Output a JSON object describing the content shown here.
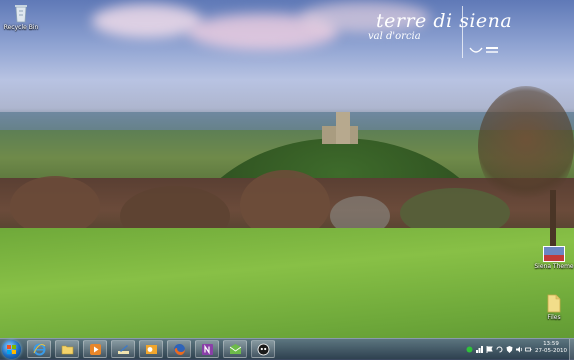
{
  "wallpaper": {
    "brand_title": "terre di siena",
    "brand_subtitle": "val d'orcia"
  },
  "desktop_icons": [
    {
      "name": "recycle-bin",
      "label": "Recycle Bin",
      "icon": "recycle-bin-icon"
    },
    {
      "name": "siena-theme",
      "label": "Siena Theme",
      "icon": "image-thumbnail-icon"
    },
    {
      "name": "files",
      "label": "Files",
      "icon": "folder-icon"
    }
  ],
  "taskbar": {
    "start_icon": "windows-start-orb",
    "pinned": [
      {
        "name": "internet-explorer",
        "icon": "internet-explorer-icon"
      },
      {
        "name": "windows-explorer",
        "icon": "folder-icon"
      },
      {
        "name": "media-player",
        "icon": "media-play-icon"
      },
      {
        "name": "paint",
        "icon": "paint-icon"
      },
      {
        "name": "outlook",
        "icon": "outlook-icon"
      },
      {
        "name": "firefox",
        "icon": "firefox-icon"
      },
      {
        "name": "onenote",
        "icon": "onenote-icon"
      },
      {
        "name": "live-mail",
        "icon": "mail-icon"
      },
      {
        "name": "skype",
        "icon": "chat-icon"
      }
    ],
    "tray_icons": [
      "status-icon",
      "network-icon",
      "flag-icon",
      "sync-icon",
      "shield-icon",
      "volume-icon",
      "power-icon"
    ],
    "clock_time": "13:59",
    "clock_date": "27-05-2010"
  },
  "colors": {
    "taskbar": "#2d3a52",
    "start_orb": "#1c6cc0",
    "meadow": "#88c046"
  }
}
